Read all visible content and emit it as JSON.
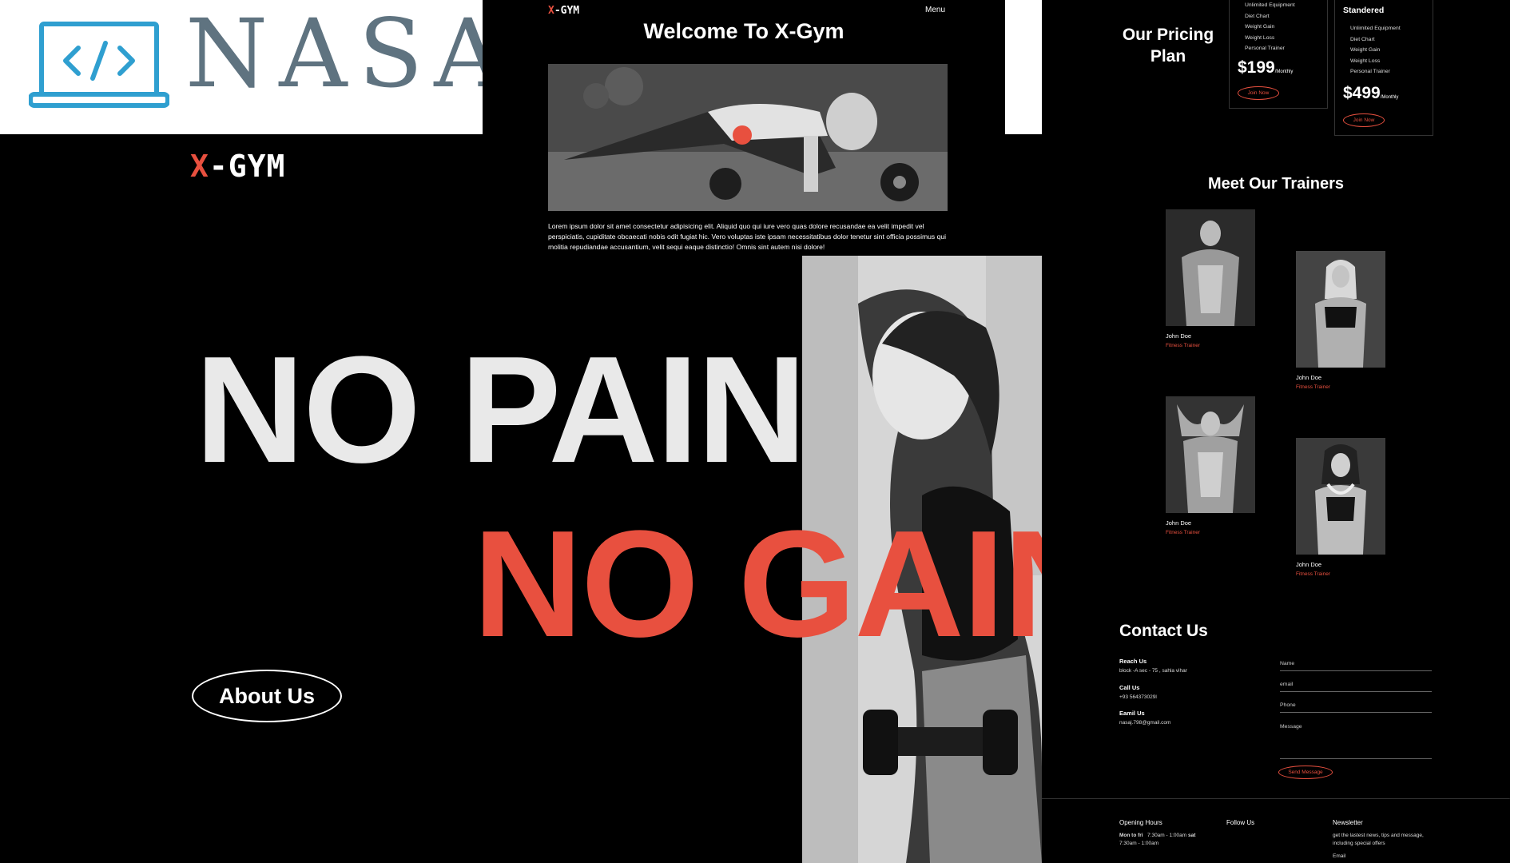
{
  "brand_logo": {
    "word": "NASAJ",
    "icon": "laptop-code-icon"
  },
  "hero": {
    "brand_x": "X",
    "brand_rest": "-GYM",
    "line1": "NO PAIN",
    "line2": "NO GAIN",
    "about_button": "About Us",
    "photo": "woman-dumbbell-photo"
  },
  "welcome": {
    "brand_x": "X",
    "brand_rest": "-GYM",
    "menu": "Menu",
    "title": "Welcome To X-Gym",
    "photo": "man-pushup-kettlebell-photo",
    "body": "Lorem ipsum dolor sit amet consectetur adipisicing elit. Aliquid quo qui iure vero quas dolore recusandae ea velit impedit vel perspiciatis, cupiditate obcaecati nobis odit fugiat hic. Vero voluptas iste ipsam necessitatibus dolor tenetur sint officia possimus qui molitia repudiandae accusantium, velit sequi eaque distinctio! Omnis sint autem nisi dolore!"
  },
  "pricing": {
    "title": "Our Pricing Plan",
    "plans": [
      {
        "name": "",
        "features": [
          "Unlimited Equipment",
          "Diet Chart",
          "Weight Gain",
          "Weight Loss",
          "Personal Trainer"
        ],
        "price": "$199",
        "period": "/Monthly",
        "button": "Join Now"
      },
      {
        "name": "Standered",
        "features": [
          "Unlimited Equipment",
          "Diet Chart",
          "Weight Gain",
          "Weight Loss",
          "Personal Trainer"
        ],
        "price": "$499",
        "period": "/Monthly",
        "button": "Join Now"
      }
    ]
  },
  "trainers": {
    "title": "Meet Our Trainers",
    "items": [
      {
        "name": "John Doe",
        "role": "Fitness Trainer",
        "photo": "male-trainer-photo"
      },
      {
        "name": "John Doe",
        "role": "Fitness Trainer",
        "photo": "female-trainer-photo"
      },
      {
        "name": "John Doe",
        "role": "Fitness Trainer",
        "photo": "male-trainer-arms-up-photo"
      },
      {
        "name": "John Doe",
        "role": "Fitness Trainer",
        "photo": "female-trainer-smiling-photo"
      }
    ]
  },
  "contact": {
    "title": "Contact Us",
    "reach_label": "Reach Us",
    "reach_value": "block -A sec - 75 , sahla vihar",
    "call_label": "Call Us",
    "call_value": "+93 564373029l",
    "email_label": "Eamil Us",
    "email_value": "nasaj.798@gmail.com",
    "form": {
      "name": "Name",
      "email": "email",
      "phone": "Phone",
      "message": "Message",
      "send": "Send Message"
    }
  },
  "footer": {
    "hours_title": "Opening Hours",
    "hours_line1_days": "Mon to fri",
    "hours_line1_time": "7:30am - 1:00am",
    "hours_line1_sat": "sat",
    "hours_line2": "7:30am - 1:00am",
    "follow_title": "Follow Us",
    "newsletter_title": "Newsletter",
    "newsletter_text": "get the lastest news, tips and message, including special offers",
    "newsletter_email": "Email"
  },
  "colors": {
    "accent": "#e8503f",
    "background": "#000000",
    "logo_blue": "#2f9fd0",
    "logo_grey": "#5f7380"
  }
}
